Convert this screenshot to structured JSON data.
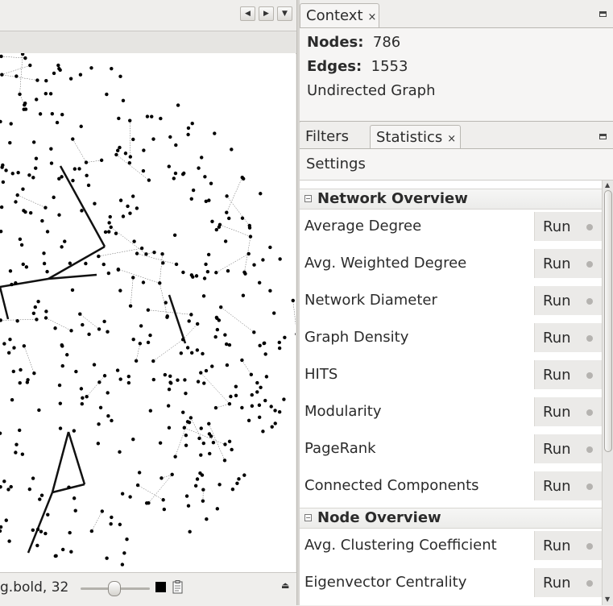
{
  "left_panel": {
    "nav": {
      "prev": "◀",
      "next": "▶",
      "menu": "▼"
    },
    "bottom_bar": {
      "font_label": "g.bold, 32",
      "node_color": "#000000"
    }
  },
  "context": {
    "tab_label": "Context",
    "close": "×",
    "nodes_label": "Nodes:",
    "nodes_value": "786",
    "edges_label": "Edges:",
    "edges_value": "1553",
    "graph_type": "Undirected Graph"
  },
  "stats_tabs": {
    "filters": "Filters",
    "statistics": "Statistics",
    "close": "×"
  },
  "settings_label": "Settings",
  "sections": [
    {
      "title": "Network Overview",
      "toggle": "−",
      "items": [
        {
          "label": "Average Degree",
          "run": "Run"
        },
        {
          "label": "Avg. Weighted Degree",
          "run": "Run"
        },
        {
          "label": "Network Diameter",
          "run": "Run"
        },
        {
          "label": "Graph Density",
          "run": "Run"
        },
        {
          "label": "HITS",
          "run": "Run"
        },
        {
          "label": "Modularity",
          "run": "Run"
        },
        {
          "label": "PageRank",
          "run": "Run"
        },
        {
          "label": "Connected Components",
          "run": "Run"
        }
      ]
    },
    {
      "title": "Node Overview",
      "toggle": "−",
      "items": [
        {
          "label": "Avg. Clustering Coefficient",
          "run": "Run"
        },
        {
          "label": "Eigenvector Centrality",
          "run": "Run"
        }
      ]
    }
  ],
  "colors": {
    "accent_bg": "#efeeec",
    "panel_bg": "#f6f5f4",
    "run_bg": "#ebeae8"
  }
}
